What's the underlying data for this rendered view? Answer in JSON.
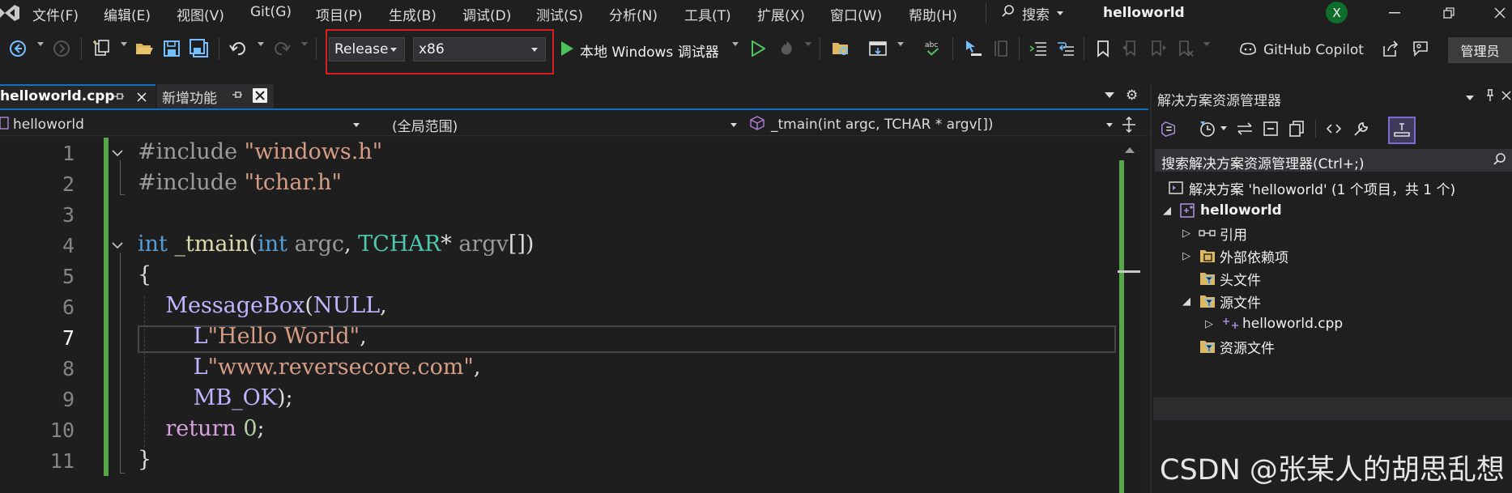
{
  "menubar": {
    "items": [
      "文件(F)",
      "编辑(E)",
      "视图(V)",
      "Git(G)",
      "项目(P)",
      "生成(B)",
      "调试(D)",
      "测试(S)",
      "分析(N)",
      "工具(T)",
      "扩展(X)",
      "窗口(W)",
      "帮助(H)"
    ],
    "search_label": "搜索",
    "app_title": "helloworld",
    "account_initial": "X"
  },
  "toolbar": {
    "configuration": "Release",
    "platform": "x86",
    "debugger_label": "本地 Windows 调试器",
    "copilot_label": "GitHub Copilot",
    "admin_label": "管理员"
  },
  "editor_tabs": [
    {
      "label": "helloworld.cpp",
      "active": true
    },
    {
      "label": "新增功能",
      "active": false
    }
  ],
  "navbar": {
    "project": "helloworld",
    "scope": "(全局范围)",
    "member": "_tmain(int argc, TCHAR * argv[])"
  },
  "code": {
    "line_numbers": [
      "1",
      "2",
      "3",
      "4",
      "5",
      "6",
      "7",
      "8",
      "9",
      "10",
      "11"
    ],
    "current_line": 7,
    "tokens": {
      "l1_pp": "#include",
      "l1_str": "\"windows.h\"",
      "l2_pp": "#include",
      "l2_str": "\"tchar.h\"",
      "l4_kw_int": "int",
      "l4_fn": "_tmain",
      "l4_paren_open": "(",
      "l4_kw_int2": "int",
      "l4_argc": "argc",
      "l4_comma": ",",
      "l4_type": "TCHAR",
      "l4_star": "*",
      "l4_argv": "argv",
      "l4_rest": "[])",
      "l5": "{",
      "l6_macro": "MessageBox",
      "l6_paren": "(",
      "l6_null": "NULL",
      "l6_comma": ",",
      "l7_prefix": "L",
      "l7_str": "\"Hello World\"",
      "l7_comma": ",",
      "l8_prefix": "L",
      "l8_str": "\"www.reversecore.com\"",
      "l8_comma": ",",
      "l9_macro": "MB_OK",
      "l9_rest": ");",
      "l10_kw": "return",
      "l10_num": "0",
      "l10_semi": ";",
      "l11": "}"
    }
  },
  "solution_explorer": {
    "title": "解决方案资源管理器",
    "search_placeholder": "搜索解决方案资源管理器(Ctrl+;)",
    "tree": [
      {
        "label": "解决方案 'helloworld' (1 个项目，共 1 个)",
        "icon": "solution-icon"
      },
      {
        "label": "helloworld",
        "icon": "cpp-project-icon",
        "expanded": true
      },
      {
        "label": "引用",
        "icon": "references-icon",
        "expanded": false
      },
      {
        "label": "外部依赖项",
        "icon": "external-deps-icon",
        "expanded": false
      },
      {
        "label": "头文件",
        "icon": "folder-filter-icon"
      },
      {
        "label": "源文件",
        "icon": "folder-filter-icon",
        "expanded": true
      },
      {
        "label": "helloworld.cpp",
        "icon": "cpp-file-icon",
        "expanded": false,
        "selected": true
      },
      {
        "label": "资源文件",
        "icon": "folder-filter-icon"
      }
    ]
  },
  "watermark": "CSDN @张某人的胡思乱想",
  "colors": {
    "accent": "#0e70c0",
    "highlight_box": "#d81e1e",
    "change_bar": "#57a64a",
    "account": "#106e2c"
  }
}
